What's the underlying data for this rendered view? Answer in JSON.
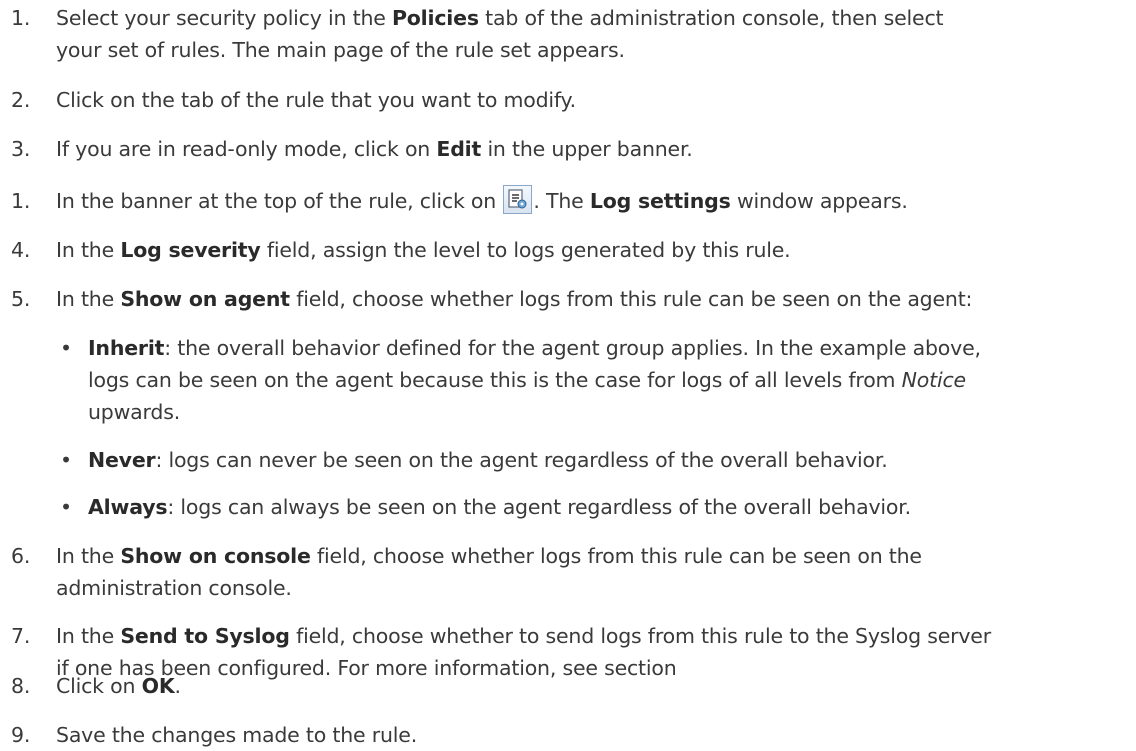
{
  "steps": [
    {
      "num": "1.",
      "a": "Select your security policy in the ",
      "b1": "Policies",
      "c": " tab of the administration console, then select",
      "line2": "your set of rules. The main page of the rule set appears."
    },
    {
      "num": "2.",
      "a": "Click on the tab of the rule that you want to modify."
    },
    {
      "num": "3.",
      "a": "If you are in read-only mode, click on ",
      "b1": "Edit",
      "c": " in the upper banner."
    },
    {
      "num": "1.",
      "a": "In the banner at the top of the rule, click on ",
      "icon": "log-settings-icon",
      "c": ". The ",
      "b1": "Log settings",
      "d": " window appears."
    },
    {
      "num": "4.",
      "a": "In the ",
      "b1": "Log severity",
      "c": " field, assign the level to logs generated by this rule."
    },
    {
      "num": "5.",
      "a": "In the ",
      "b1": "Show on agent",
      "c": " field, choose whether logs from this rule can be seen on the agent:"
    },
    {
      "num": "6.",
      "a": "In the ",
      "b1": "Show on console",
      "c": " field, choose whether logs from this rule can be seen on the",
      "line2": "administration console."
    },
    {
      "num": "7.",
      "a": "In the ",
      "b1": "Send to Syslog",
      "c": " field, choose whether to send logs from this rule to the Syslog server",
      "line2": "if one has been configured. For more information, see section"
    },
    {
      "num": "8.",
      "a": "Click on ",
      "b1": "OK",
      "c": "."
    },
    {
      "num": "9.",
      "a": "Save the changes made to the rule."
    }
  ],
  "bullets": [
    {
      "label": "Inherit",
      "text1": ": the overall behavior defined for the agent group applies. In the example above,",
      "text2a": "logs can be seen on the agent because this is the case for logs of all levels from ",
      "text2i": "Notice",
      "text3": "upwards."
    },
    {
      "label": "Never",
      "text1": ": logs can never be seen on the agent regardless of the overall behavior."
    },
    {
      "label": "Always",
      "text1": ": logs can always be seen on the agent regardless of the overall behavior."
    }
  ]
}
